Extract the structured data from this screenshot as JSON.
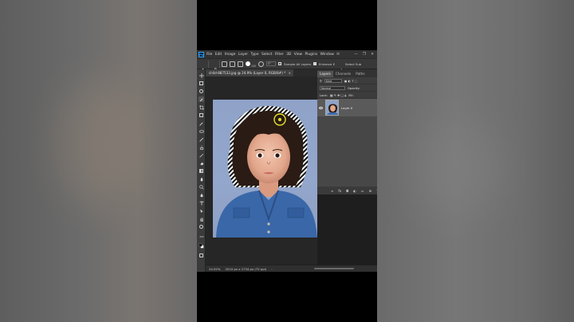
{
  "app": {
    "menu": [
      "File",
      "Edit",
      "Image",
      "Layer",
      "Type",
      "Select",
      "Filter",
      "3D",
      "View",
      "Plugins",
      "Window",
      "H"
    ],
    "window_controls": [
      "—",
      "❐",
      "✕"
    ],
    "logo_text": "Ps"
  },
  "options_bar": {
    "brush_size": "100",
    "angle": "0°",
    "sample_all_layers": "Sample All Layers",
    "enhance_edge": "Enhance E",
    "select_subject": "Select Sub"
  },
  "document": {
    "tab_title": "child-887533.jpg @ 24.9% (Layer 0, RGB/8#) *",
    "zoom": "24.92%",
    "dimensions": "2010 px x 2734 px (72 ppi)"
  },
  "layers_panel": {
    "tabs": [
      "Layers",
      "Channels",
      "Paths"
    ],
    "filter_label": "Kind",
    "blend_mode": "Normal",
    "opacity_label": "Opacity:",
    "lock_label": "Lock:",
    "fill_label": "Fill:",
    "layer_name": "Layer 0"
  },
  "colors": {
    "accent": "#31a8ff",
    "panel_bg": "#535353",
    "canvas_bg": "#262626",
    "photo_bg": "#8fa2c8",
    "brush_indicator": "#e5e22a"
  }
}
